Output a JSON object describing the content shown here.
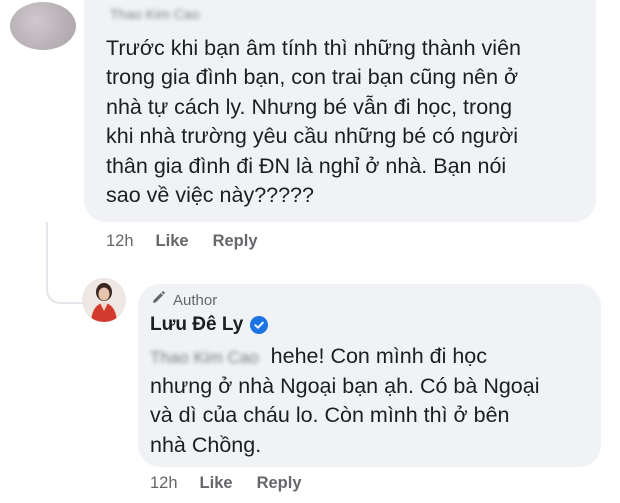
{
  "comment": {
    "author_name": "Thao Kim Cao",
    "lines": [
      "Trước khi bạn âm tính thì những thành viên",
      "trong gia đình bạn, con trai bạn cũng nên ở",
      "nhà tự cách ly. Nhưng bé vẫn đi học, trong",
      "khi nhà trường yêu cầu những bé có người",
      "thân gia đình đi ĐN là nghỉ ở nhà. Bạn nói",
      "sao về việc này?????"
    ],
    "time": "12h",
    "like_label": "Like",
    "reply_label": "Reply"
  },
  "reply": {
    "author_badge": "Author",
    "author_name": "Lưu Đê Ly",
    "mention": "Thao Kim Cao",
    "lines": [
      "hehe! Con mình đi học",
      "nhưng ở nhà Ngoại bạn ạh. Có bà Ngoại",
      "và dì của cháu lo. Còn mình thì ở bên",
      "nhà Chồng."
    ],
    "time": "12h",
    "like_label": "Like",
    "reply_label": "Reply"
  },
  "icons": {
    "author_badge_icon": "pencil-icon",
    "verified_icon": "verified-badge-icon"
  },
  "colors": {
    "bubble": "#f0f2f5",
    "verified": "#1b74e4",
    "secondary_text": "#65676b"
  }
}
